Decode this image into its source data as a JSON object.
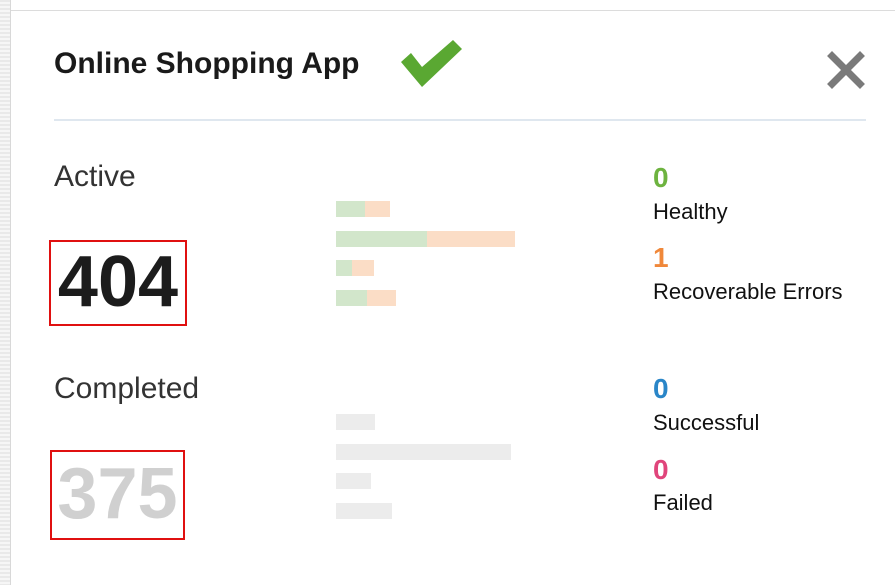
{
  "card": {
    "title": "Online Shopping App",
    "status_icon": "check-icon",
    "close_icon": "close-icon",
    "colors": {
      "check": "#5aa832",
      "close": "#7a7a7a",
      "highlight_border": "#e01010"
    }
  },
  "active": {
    "label": "Active",
    "count": "404",
    "stats": [
      {
        "value": "0",
        "label": "Healthy",
        "color": "#6db33f"
      },
      {
        "value": "1",
        "label": "Recoverable Errors",
        "color": "#f0883a"
      }
    ]
  },
  "completed": {
    "label": "Completed",
    "count": "375",
    "stats": [
      {
        "value": "0",
        "label": "Successful",
        "color": "#2a86c8"
      },
      {
        "value": "0",
        "label": "Failed",
        "color": "#e0457b"
      }
    ]
  }
}
